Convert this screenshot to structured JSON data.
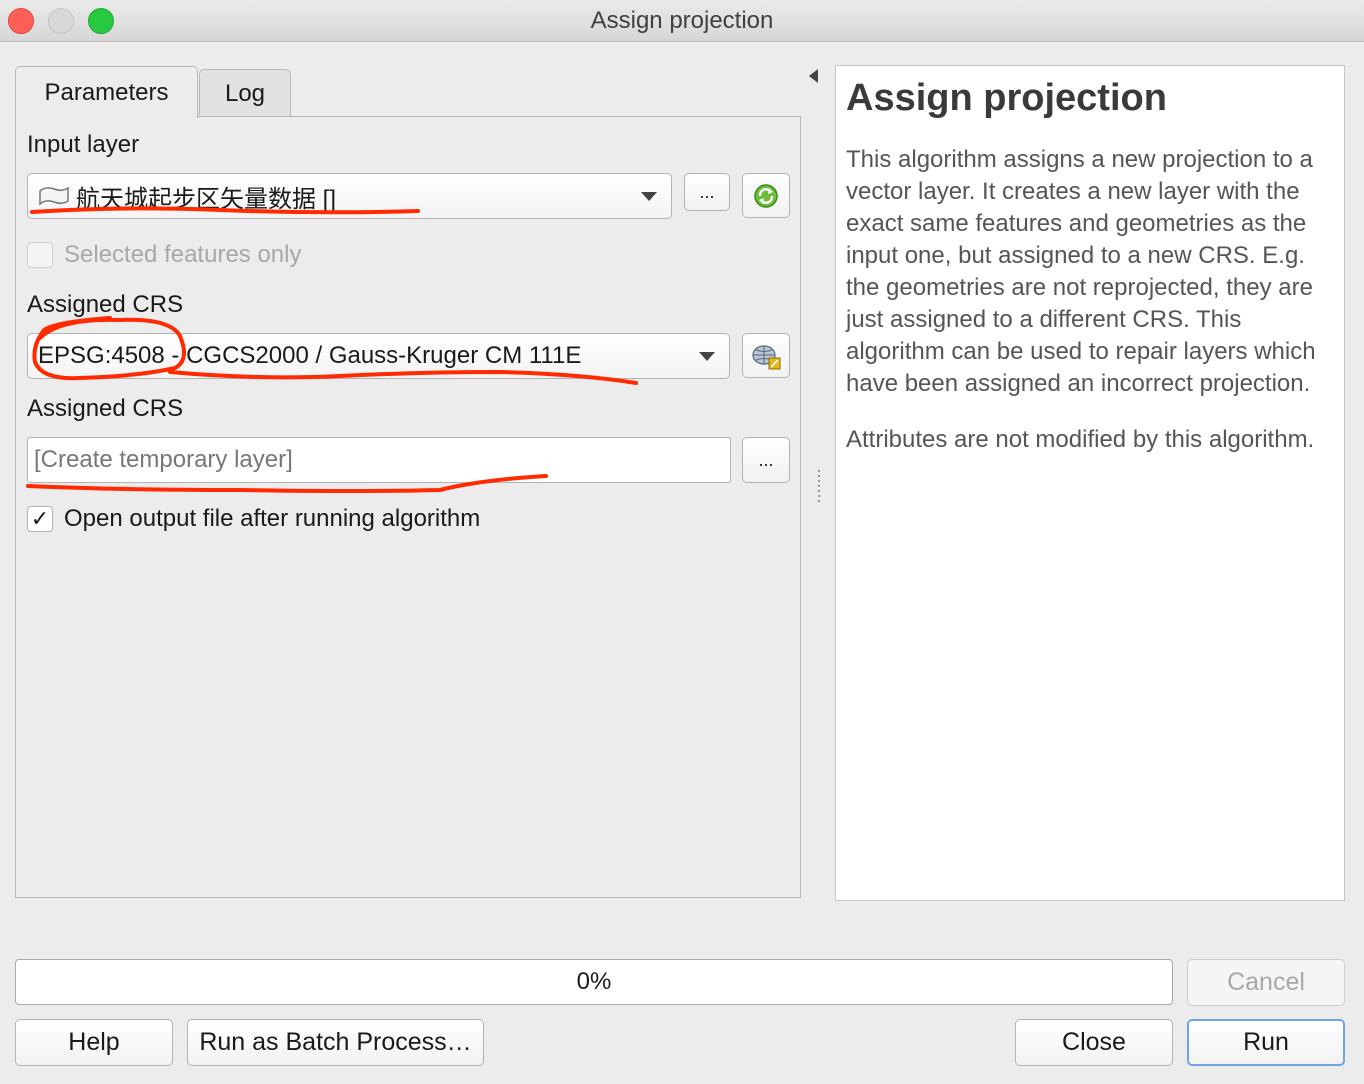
{
  "window": {
    "title": "Assign projection"
  },
  "tabs": [
    {
      "label": "Parameters",
      "active": true
    },
    {
      "label": "Log",
      "active": false
    }
  ],
  "form": {
    "input_layer_label": "Input layer",
    "input_layer_value": "航天城起步区矢量数据 []",
    "input_layer_more": "...",
    "selected_only_label": "Selected features only",
    "assigned_crs_label": "Assigned CRS",
    "assigned_crs_value": "EPSG:4508 - CGCS2000 / Gauss-Kruger CM 111E",
    "output_label": "Assigned CRS",
    "output_placeholder": "[Create temporary layer]",
    "output_more": "...",
    "open_output_label": "Open output file after running algorithm",
    "open_output_checked": "✓"
  },
  "help": {
    "title": "Assign projection",
    "paragraph1": "This algorithm assigns a new projection to a vector layer. It creates a new layer with the exact same features and geometries as the input one, but assigned to a new CRS. E.g. the geometries are not reprojected, they are just assigned to a different CRS. This algorithm can be used to repair layers which have been assigned an incorrect projection.",
    "paragraph2": "Attributes are not modified by this algorithm."
  },
  "progress": {
    "text": "0%",
    "value": 0
  },
  "buttons": {
    "cancel": "Cancel",
    "help": "Help",
    "batch": "Run as Batch Process…",
    "close": "Close",
    "run": "Run"
  },
  "icons": {
    "layer": "polygon-layer-icon",
    "iterate": "iterate-refresh-icon",
    "crs": "crs-globe-icon"
  },
  "colors": {
    "annotation": "#ff2a00",
    "accent": "#6fa3e6"
  }
}
